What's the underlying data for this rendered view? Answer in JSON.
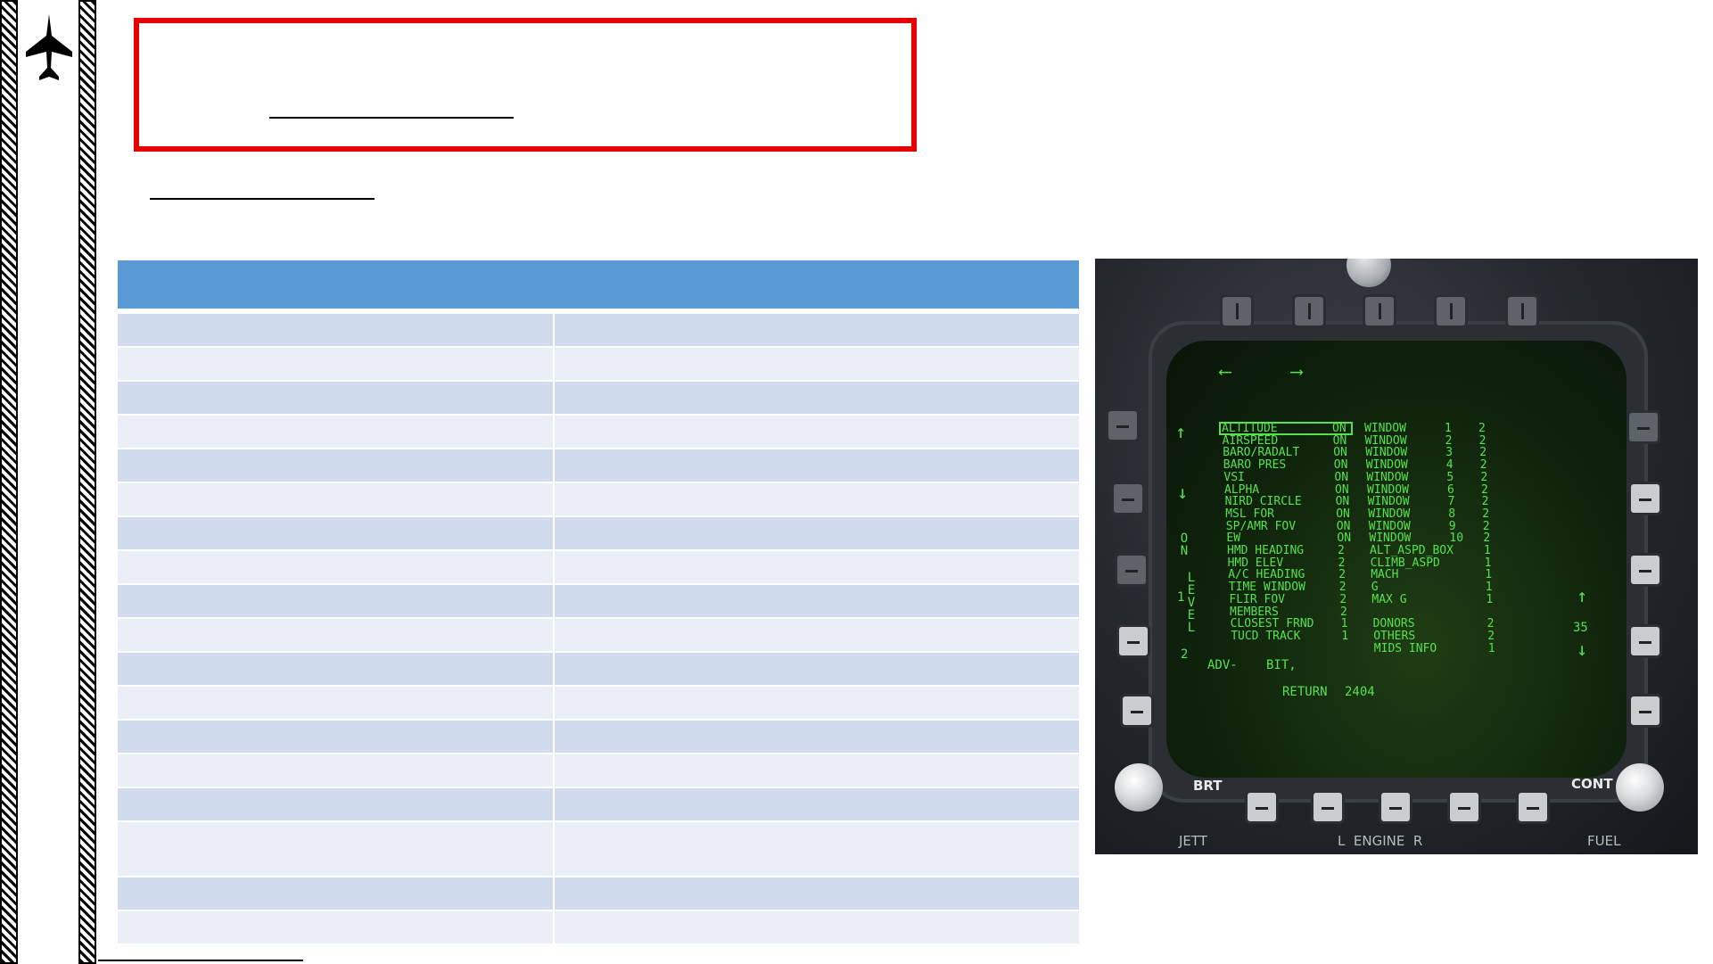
{
  "mfd": {
    "rows": [
      {
        "name": "ALTITUDE",
        "state": "ON",
        "window": "WINDOW",
        "num": "1",
        "lvl": "2",
        "selected": true
      },
      {
        "name": "AIRSPEED",
        "state": "ON",
        "window": "WINDOW",
        "num": "2",
        "lvl": "2"
      },
      {
        "name": "BARO/RADALT",
        "state": "ON",
        "window": "WINDOW",
        "num": "3",
        "lvl": "2"
      },
      {
        "name": "BARO PRES",
        "state": "ON",
        "window": "WINDOW",
        "num": "4",
        "lvl": "2"
      },
      {
        "name": "VSI",
        "state": "ON",
        "window": "WINDOW",
        "num": "5",
        "lvl": "2"
      },
      {
        "name": "ALPHA",
        "state": "ON",
        "window": "WINDOW",
        "num": "6",
        "lvl": "2"
      },
      {
        "name": "NIRD CIRCLE",
        "state": "ON",
        "window": "WINDOW",
        "num": "7",
        "lvl": "2"
      },
      {
        "name": "MSL FOR",
        "state": "ON",
        "window": "WINDOW",
        "num": "8",
        "lvl": "2"
      },
      {
        "name": "SP/AMR FOV",
        "state": "ON",
        "window": "WINDOW",
        "num": "9",
        "lvl": "2"
      },
      {
        "name": "EW",
        "state": "ON",
        "window": "WINDOW",
        "num": "10",
        "lvl": "2"
      },
      {
        "name": "HMD HEADING",
        "state": "2",
        "window": "ALT_ASPD_BOX",
        "num": "",
        "lvl": "1"
      },
      {
        "name": "HMD ELEV",
        "state": "2",
        "window": "CLIMB_ASPD",
        "num": "",
        "lvl": "1"
      },
      {
        "name": "A/C HEADING",
        "state": "2",
        "window": "MACH",
        "num": "",
        "lvl": "1"
      },
      {
        "name": "TIME WINDOW",
        "state": "2",
        "window": "G",
        "num": "",
        "lvl": "1"
      },
      {
        "name": "FLIR FOV",
        "state": "2",
        "window": "MAX G",
        "num": "",
        "lvl": "1"
      },
      {
        "name": "MEMBERS",
        "state": "2",
        "window": "",
        "num": "",
        "lvl": ""
      },
      {
        "name": "CLOSEST FRND",
        "state": "1",
        "window": "DONORS",
        "num": "",
        "lvl": "2"
      },
      {
        "name": "TUCD TRACK",
        "state": "1",
        "window": "OTHERS",
        "num": "",
        "lvl": "2"
      },
      {
        "name": "",
        "state": "",
        "window": "MIDS INFO",
        "num": "",
        "lvl": "1"
      }
    ],
    "side_on": "ON",
    "side_level": "LEVEL",
    "level_1": "1",
    "level_2": "2",
    "right_num": "35",
    "adv": "ADV-",
    "bit": "BIT,",
    "return_label": "RETURN",
    "return_num": "2404",
    "brt_label": "BRT",
    "cont_label": "CONT",
    "bottom_labels": {
      "jett": "JETT",
      "engine": "L  ENGINE  R",
      "fuel": "FUEL"
    }
  }
}
